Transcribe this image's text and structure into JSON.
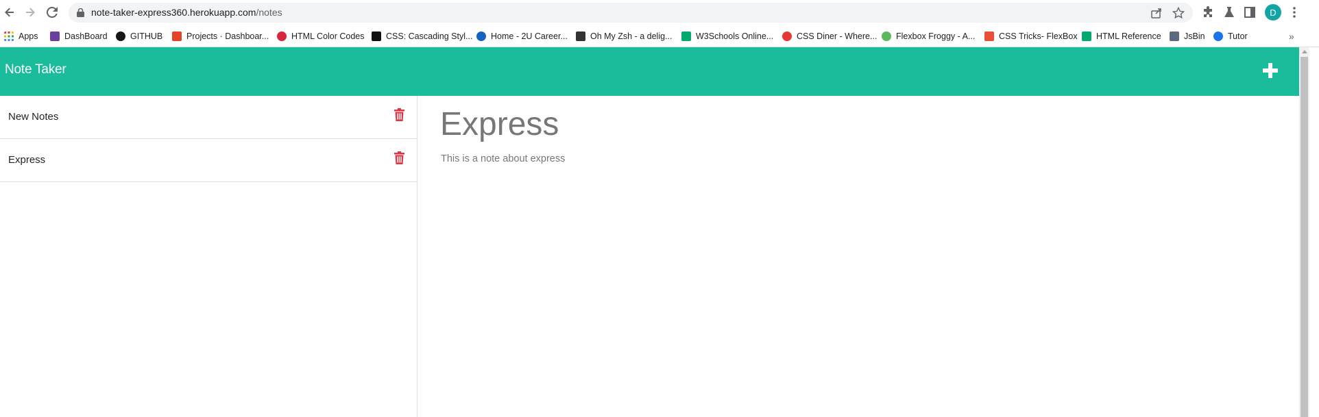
{
  "browser": {
    "url_host": "note-taker-express360.herokuapp.com",
    "url_path": "/notes",
    "profile_initial": "D"
  },
  "bookmarks": [
    {
      "label": "Apps",
      "icon": "apps-grid-icon",
      "color": "#e94235"
    },
    {
      "label": "DashBoard",
      "icon": "dashboard-icon",
      "color": "#6b3fa0"
    },
    {
      "label": "GITHUB",
      "icon": "github-icon",
      "color": "#181717"
    },
    {
      "label": "Projects · Dashboar...",
      "icon": "gitlab-icon",
      "color": "#e24329"
    },
    {
      "label": "HTML Color Codes",
      "icon": "html-color-codes-icon",
      "color": "#d7263d"
    },
    {
      "label": "CSS: Cascading Styl...",
      "icon": "mdn-icon",
      "color": "#111111"
    },
    {
      "label": "Home - 2U Career...",
      "icon": "2u-icon",
      "color": "#1565c0"
    },
    {
      "label": "Oh My Zsh - a delig...",
      "icon": "terminal-icon",
      "color": "#333333"
    },
    {
      "label": "W3Schools Online...",
      "icon": "w3schools-icon",
      "color": "#04aa6d"
    },
    {
      "label": "CSS Diner - Where...",
      "icon": "css-diner-icon",
      "color": "#e53935"
    },
    {
      "label": "Flexbox Froggy - A...",
      "icon": "froggy-icon",
      "color": "#5cb85c"
    },
    {
      "label": "CSS Tricks- FlexBox",
      "icon": "css-tricks-icon",
      "color": "#e8503a"
    },
    {
      "label": "HTML Reference",
      "icon": "w3schools-icon",
      "color": "#04aa6d"
    },
    {
      "label": "JsBin",
      "icon": "jsbin-icon",
      "color": "#5b6b7d"
    },
    {
      "label": "Tutor",
      "icon": "tutor-icon",
      "color": "#1a73e8"
    }
  ],
  "header": {
    "title": "Note Taker",
    "add_icon": "plus-icon",
    "bg_color": "#1abc9c"
  },
  "notes": [
    {
      "title": "New Notes"
    },
    {
      "title": "Express"
    }
  ],
  "active_note": {
    "title": "Express",
    "text": "This is a note about express"
  },
  "colors": {
    "delete_icon": "#dc3545",
    "note_text": "#777777"
  }
}
